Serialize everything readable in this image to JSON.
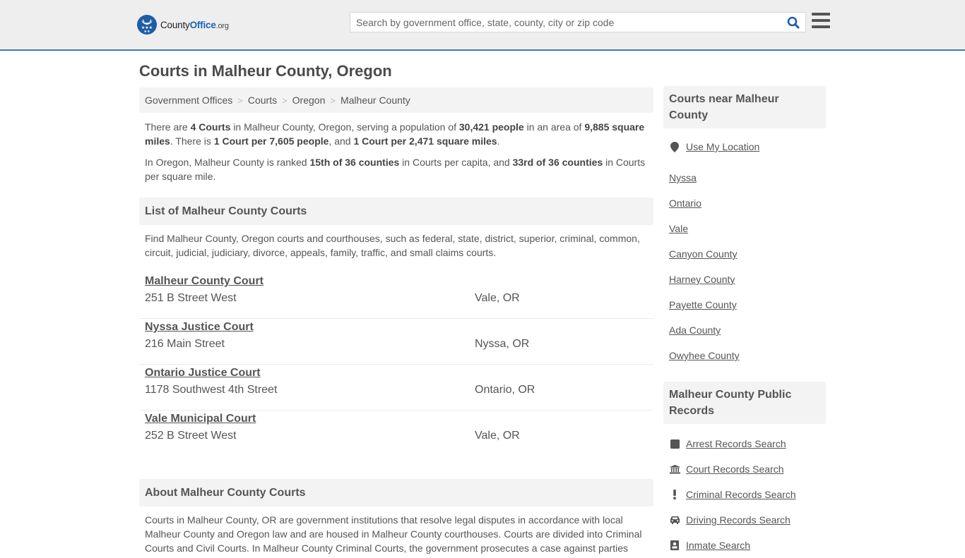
{
  "header": {
    "logo": {
      "name_part1": "County",
      "name_part2": "Office",
      "tld": ".org"
    },
    "search": {
      "placeholder": "Search by government office, state, county, city or zip code",
      "value": ""
    },
    "search_icon": "search-icon",
    "menu_icon": "hamburger-menu-icon"
  },
  "colors": {
    "accent": "#3c7ab3",
    "logo_blue": "#1d5ea8",
    "header_bg": "#eeeeee",
    "panel_bg": "#f3f3f3",
    "text": "#555555"
  },
  "page": {
    "title": "Courts in Malheur County, Oregon"
  },
  "breadcrumb": [
    {
      "label": "Government Offices"
    },
    {
      "label": "Courts"
    },
    {
      "label": "Oregon"
    },
    {
      "label": "Malheur County"
    }
  ],
  "summary": {
    "p1": {
      "t1": "There are ",
      "b1": "4 Courts",
      "t2": " in Malheur County, Oregon, serving a population of ",
      "b2": "30,421 people",
      "t3": " in an area of ",
      "b3": "9,885 square miles",
      "t4": ". There is ",
      "b4": "1 Court per 7,605 people",
      "t5": ", and ",
      "b5": "1 Court per 2,471 square miles",
      "t6": "."
    },
    "p2": {
      "t1": "In Oregon, Malheur County is ranked ",
      "b1": "15th of 36 counties",
      "t2": " in Courts per capita, and ",
      "b2": "33rd of 36 counties",
      "t3": " in Courts per square mile."
    }
  },
  "list_section": {
    "title": "List of Malheur County Courts",
    "intro": "Find Malheur County, Oregon courts and courthouses, such as federal, state, district, superior, criminal, common, circuit, judicial, judiciary, divorce, appeals, family, traffic, and small claims courts.",
    "courts": [
      {
        "name": "Malheur County Court",
        "address": "251 B Street West",
        "city": "Vale, OR"
      },
      {
        "name": "Nyssa Justice Court",
        "address": "216 Main Street",
        "city": "Nyssa, OR"
      },
      {
        "name": "Ontario Justice Court",
        "address": "1178 Southwest 4th Street",
        "city": "Ontario, OR"
      },
      {
        "name": "Vale Municipal Court",
        "address": "252 B Street West",
        "city": "Vale, OR"
      }
    ]
  },
  "about_section": {
    "title": "About Malheur County Courts",
    "text": "Courts in Malheur County, OR are government institutions that resolve legal disputes in accordance with local Malheur County and Oregon law and are housed in Malheur County courthouses. Courts are divided into Criminal Courts and Civil Courts. In Malheur County Criminal Courts, the government prosecutes a case against parties"
  },
  "sidebar": {
    "nearby": {
      "title": "Courts near Malheur County",
      "use_location": "Use My Location",
      "items": [
        "Nyssa",
        "Ontario",
        "Vale",
        "Canyon County",
        "Harney County",
        "Payette County",
        "Ada County",
        "Owyhee County"
      ]
    },
    "records": {
      "title": "Malheur County Public Records",
      "items": [
        {
          "label": "Arrest Records Search",
          "icon": "square-icon"
        },
        {
          "label": "Court Records Search",
          "icon": "courthouse-icon"
        },
        {
          "label": "Criminal Records Search",
          "icon": "exclamation-icon"
        },
        {
          "label": "Driving Records Search",
          "icon": "car-icon"
        },
        {
          "label": "Inmate Search",
          "icon": "inmate-icon"
        }
      ]
    }
  }
}
